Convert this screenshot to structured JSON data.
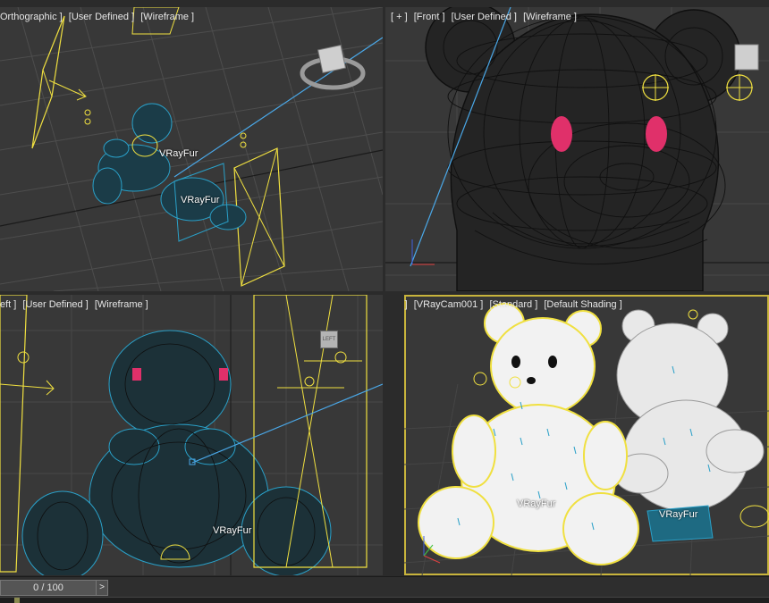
{
  "viewports": {
    "top_left": {
      "label_parts": [
        "Orthographic ]",
        "[User Defined ]",
        "[Wireframe ]"
      ],
      "objects": [
        "VRayFur",
        "VRayFur"
      ]
    },
    "top_right": {
      "label_parts": [
        "[ + ]",
        "[Front ]",
        "[User Defined ]",
        "[Wireframe ]"
      ]
    },
    "bottom_left": {
      "label_parts": [
        "eft ]",
        "[User Defined ]",
        "[Wireframe ]"
      ],
      "objects": [
        "VRayFur"
      ],
      "viewcube_label": "LEFT"
    },
    "bottom_right": {
      "label_parts": [
        "[ + ]",
        "[VRayCam001 ]",
        "[Standard ]",
        "[Default Shading ]"
      ],
      "objects": [
        "VRayFur",
        "VRayFur"
      ]
    }
  },
  "timeline": {
    "frame_display": "0 / 100",
    "next_button": ">"
  },
  "colors": {
    "viewport_bg": "#383838",
    "grid": "#4a4a4a",
    "wire_dark": "#111111",
    "fur_cyan": "#2aa0c8",
    "helper_yellow": "#f0e040",
    "eye_magenta": "#e0306a",
    "active_border": "#c8b43c"
  }
}
